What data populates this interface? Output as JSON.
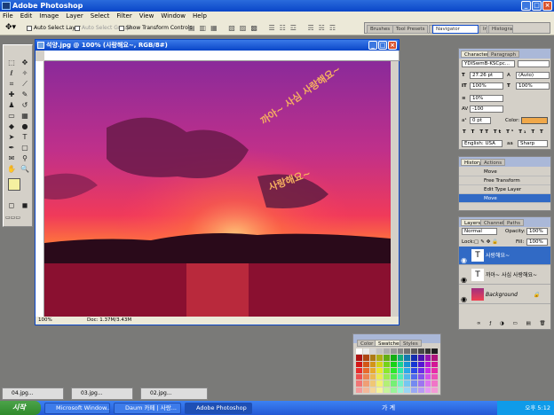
{
  "app": {
    "title": "Adobe Photoshop"
  },
  "menu": [
    "File",
    "Edit",
    "Image",
    "Layer",
    "Select",
    "Filter",
    "View",
    "Window",
    "Help"
  ],
  "options": {
    "auto_select": "Auto Select Layer",
    "auto_groups": "Auto Select Groups",
    "transform": "Show Transform Controls"
  },
  "well_tabs": [
    "Brushes",
    "Tool Presets",
    "Layer Comps",
    "Navigator",
    "Info",
    "Histogram"
  ],
  "document": {
    "title": "석양.jpg @ 100% (사랑해요~, RGB/8#)",
    "zoom": "100%",
    "doc_info": "Doc: 1.37M/3.43M",
    "text1": "까아~ 사심 사랑해요~",
    "text2": "사랑해요~"
  },
  "character": {
    "tabs": [
      "Character",
      "Paragraph"
    ],
    "font": "YDISwmB-KSCpc...",
    "size": "27.26 pt",
    "leading": "(Auto)",
    "scale_v": "100%",
    "scale_h": "100%",
    "tracking": "10%",
    "kerning": "-100",
    "baseline": "0 pt",
    "color_label": "Color:",
    "language": "English: USA",
    "aa": "Sharp",
    "color": "#f0a84a"
  },
  "history": {
    "tabs": [
      "History",
      "Actions"
    ],
    "items": [
      "Move",
      "Free Transform",
      "Edit Type Layer",
      "Move"
    ]
  },
  "layers": {
    "tabs": [
      "Layers",
      "Channels",
      "Paths"
    ],
    "mode": "Normal",
    "opacity_label": "Opacity:",
    "opacity": "100%",
    "lock_label": "Lock:",
    "fill_label": "Fill:",
    "fill": "100%",
    "items": [
      "사랑해요~",
      "까아~ 사심 사랑해요~",
      "Background"
    ]
  },
  "swatches": {
    "tabs": [
      "Color",
      "Swatches",
      "Styles"
    ]
  },
  "minimized": [
    "04.jpg...",
    "03.jpg...",
    "02.jpg..."
  ],
  "taskbar": {
    "start": "시작",
    "tasks": [
      "Microsoft Window...",
      "Daum 카페 | 사랑...",
      "Adobe Photoshop"
    ],
    "ime": "가 계",
    "time": "오후 5:12"
  }
}
